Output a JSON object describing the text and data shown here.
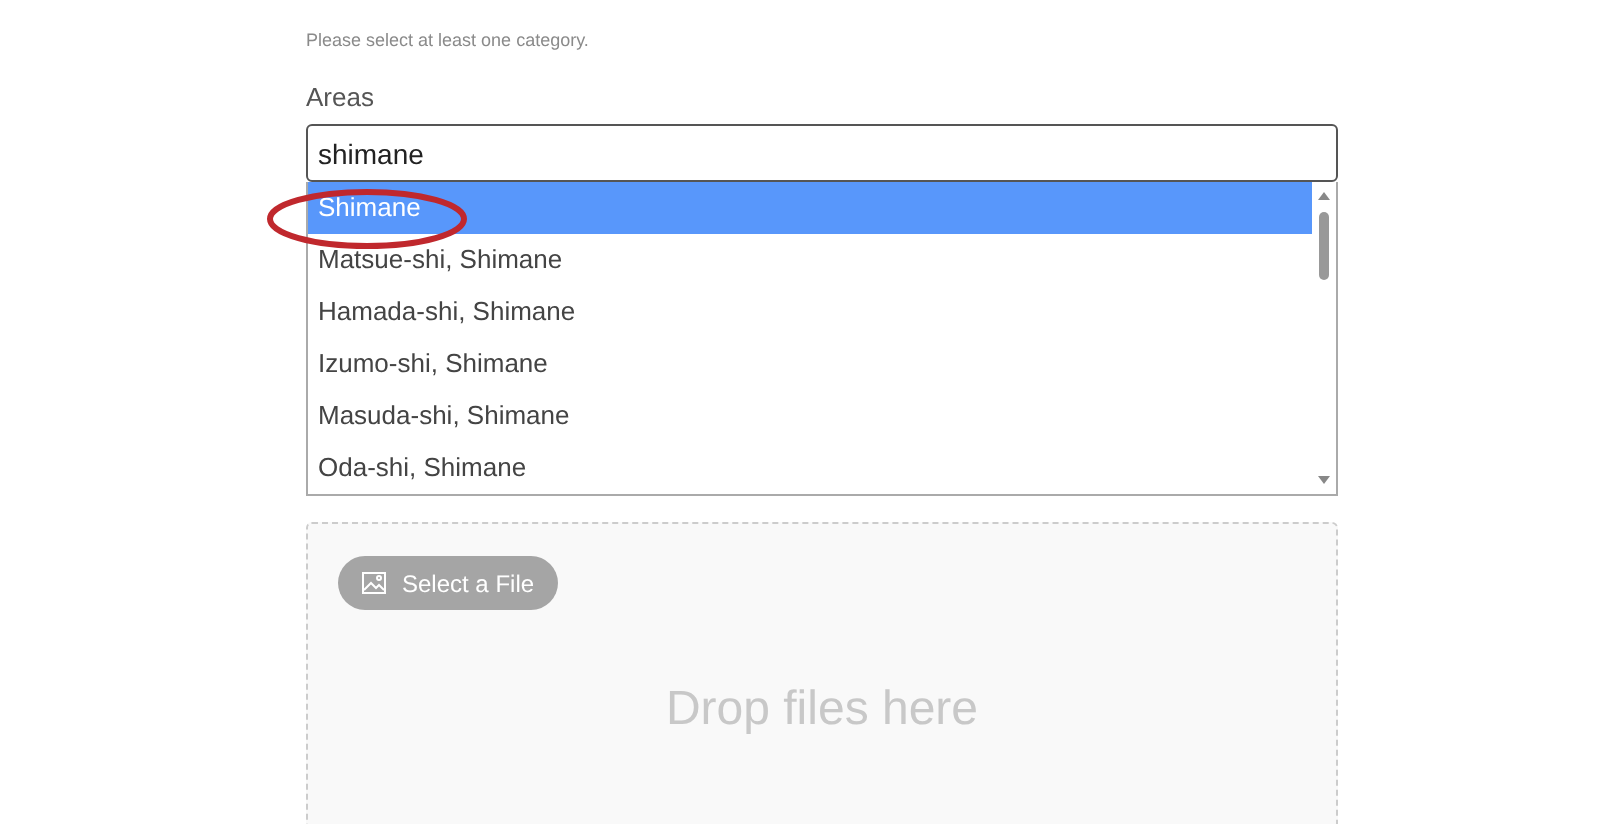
{
  "hint": "Please select at least one category.",
  "areas": {
    "label": "Areas",
    "value": "shimane",
    "options": [
      {
        "label": "Shimane",
        "selected": true
      },
      {
        "label": "Matsue-shi, Shimane",
        "selected": false
      },
      {
        "label": "Hamada-shi, Shimane",
        "selected": false
      },
      {
        "label": "Izumo-shi, Shimane",
        "selected": false
      },
      {
        "label": "Masuda-shi, Shimane",
        "selected": false
      },
      {
        "label": "Oda-shi, Shimane",
        "selected": false
      }
    ]
  },
  "upload": {
    "button": "Select a File",
    "drop_text": "Drop files here"
  }
}
